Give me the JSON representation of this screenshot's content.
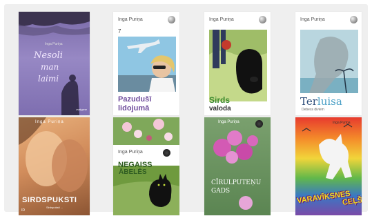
{
  "books": [
    {
      "title_line1": "Nesoli",
      "title_line2": "man",
      "title_line3": "laimi",
      "author": "Inga Puriņa",
      "publisher": "zvaigzne"
    },
    {
      "author": "Inga Puriņa",
      "number": "7",
      "title_line1": "Pazudušī",
      "title_line2": "lidojumā"
    },
    {
      "author": "Inga Puriņa",
      "title_line1": "Sirds",
      "title_line2": "valoda"
    },
    {
      "author": "Inga Puriņa",
      "title_part1": "Ter",
      "title_part2": "luisa",
      "subtitle": "Debess diviem"
    },
    {
      "author": "Inga Puriņa",
      "title": "SIRDSPUKSTI",
      "subtitle": "Sirdspuksti ...",
      "footer": "ID"
    },
    {
      "author": "Inga Puriņa",
      "title_line1": "NEGAISS",
      "title_line2": "ĀBELĒS"
    },
    {
      "author": "Inga Puriņa",
      "title_line1": "CĪRULPUTEŅU",
      "title_line2": "GADS"
    },
    {
      "author": "Inga Puriņa",
      "title_line1": "VARAVĪKSNES",
      "title_line2": "CEĻŠ"
    }
  ]
}
